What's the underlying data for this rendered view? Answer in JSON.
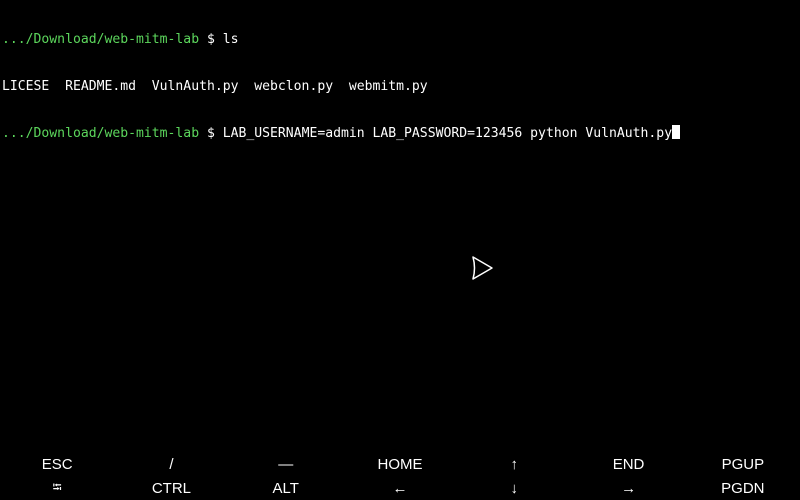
{
  "terminal": {
    "lines": [
      {
        "path": ".../Download/web-mitm-lab",
        "symbol": " $ ",
        "command": "ls"
      },
      {
        "output": "LICESE  README.md  VulnAuth.py  webclon.py  webmitm.py"
      },
      {
        "path": ".../Download/web-mitm-lab",
        "symbol": " $ ",
        "command": "LAB_USERNAME=admin LAB_PASSWORD=123456 python VulnAuth.py"
      }
    ]
  },
  "extra_keys": {
    "row1": [
      "ESC",
      "/",
      "—",
      "HOME",
      "↑",
      "END",
      "PGUP"
    ],
    "row2": [
      "⭾",
      "CTRL",
      "ALT",
      "←",
      "↓",
      "→",
      "PGDN"
    ]
  },
  "colors": {
    "background": "#000000",
    "prompt_path": "#5cd65c",
    "text": "#ffffff"
  },
  "icons": {
    "pointer": "pointer-cursor-icon",
    "tab_key": "tab-arrows-icon"
  }
}
